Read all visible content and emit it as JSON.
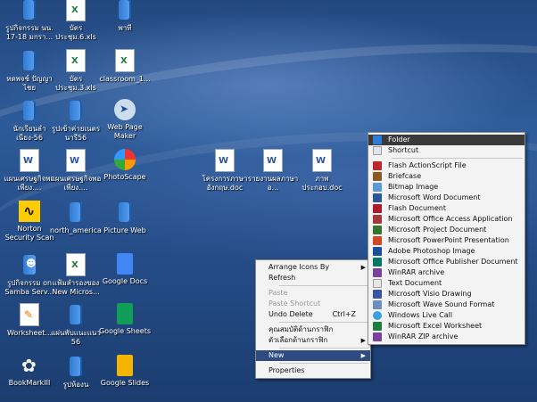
{
  "desktop": {
    "icons": [
      {
        "label": "รูปกิจกรรม นน. 17-18 มกรา...",
        "icon": "folder-icon"
      },
      {
        "label": "บัตรประชุม.6.xls",
        "icon": "excel-icon"
      },
      {
        "label": "พาที",
        "icon": "folder-icon"
      },
      {
        "label": "หดพจช์ ปัญญาไชย",
        "icon": "folder-icon"
      },
      {
        "label": "บัตรประชุม.3.xls",
        "icon": "excel-icon"
      },
      {
        "label": "classroom_1...",
        "icon": "excel-icon"
      },
      {
        "label": "นักเรียนลำเนียง-56",
        "icon": "folder-icon"
      },
      {
        "label": "รูปเข้าค่ายเนตรนารี56",
        "icon": "folder-icon"
      },
      {
        "label": "Web Page Maker",
        "icon": "web-page-maker-icon"
      },
      {
        "label": "แผนเศรษฐกิจพอเพียง....",
        "icon": "word-icon"
      },
      {
        "label": "แผนเศรษฐกิจพอเพียง....",
        "icon": "word-icon"
      },
      {
        "label": "PhotoScape",
        "icon": "photoscape-icon"
      },
      {
        "label": "โครงการภาษาอังกฤษ.doc",
        "icon": "word-icon"
      },
      {
        "label": "รายงานผลภาษาอ...",
        "icon": "word-icon"
      },
      {
        "label": "ภาพประกอบ.doc",
        "icon": "word-icon"
      },
      {
        "label": "Norton Security Scan",
        "icon": "norton-icon"
      },
      {
        "label": "north_america",
        "icon": "folder-icon"
      },
      {
        "label": "Picture Web",
        "icon": "folder-icon"
      },
      {
        "label": "รูปกิจกรรม on Samba Serv...",
        "icon": "person-folder-icon"
      },
      {
        "label": "แฟ้มสำรองของ New Micros...",
        "icon": "excel-icon"
      },
      {
        "label": "Google Docs",
        "icon": "google-docs-icon"
      },
      {
        "label": "Worksheet...",
        "icon": "pdf-icon"
      },
      {
        "label": "แผ่นพับแนะแนว 56",
        "icon": "folder-icon"
      },
      {
        "label": "Google Sheets",
        "icon": "google-sheets-icon"
      },
      {
        "label": "BookMarkIII",
        "icon": "bookmark-icon"
      },
      {
        "label": "รูปห้องน",
        "icon": "folder-icon"
      },
      {
        "label": "Google Slides",
        "icon": "google-slides-icon"
      }
    ]
  },
  "context_menu": {
    "items": [
      {
        "label": "Arrange Icons By",
        "type": "submenu"
      },
      {
        "label": "Refresh",
        "type": "item"
      },
      {
        "label": "Paste",
        "type": "disabled"
      },
      {
        "label": "Paste Shortcut",
        "type": "disabled"
      },
      {
        "label": "Undo Delete",
        "shortcut": "Ctrl+Z",
        "type": "item"
      },
      {
        "label": "คุณสมบัติด้านกราฟิก",
        "type": "item"
      },
      {
        "label": "ตัวเลือกด้านกราฟิก",
        "type": "submenu"
      },
      {
        "label": "New",
        "type": "submenu-selected"
      },
      {
        "label": "Properties",
        "type": "item"
      }
    ]
  },
  "new_submenu": {
    "items": [
      {
        "label": "Folder",
        "icon": "folder-icon",
        "color": "#2f7bd6"
      },
      {
        "label": "Shortcut",
        "icon": "shortcut-icon",
        "color": "#dfe6ef"
      },
      {
        "label": "Flash ActionScript File",
        "icon": "flash-as-icon",
        "color": "#c0272d"
      },
      {
        "label": "Briefcase",
        "icon": "briefcase-icon",
        "color": "#8a5a20"
      },
      {
        "label": "Bitmap Image",
        "icon": "bitmap-icon",
        "color": "#5b9bd5"
      },
      {
        "label": "Microsoft Word Document",
        "icon": "word-icon",
        "color": "#2b579a"
      },
      {
        "label": "Flash Document",
        "icon": "flash-icon",
        "color": "#b0182b"
      },
      {
        "label": "Microsoft Office Access Application",
        "icon": "access-icon",
        "color": "#a4373a"
      },
      {
        "label": "Microsoft Project Document",
        "icon": "project-icon",
        "color": "#31752f"
      },
      {
        "label": "Microsoft PowerPoint Presentation",
        "icon": "powerpoint-icon",
        "color": "#d24726"
      },
      {
        "label": "Adobe Photoshop Image",
        "icon": "photoshop-icon",
        "color": "#1a4f9c"
      },
      {
        "label": "Microsoft Office Publisher Document",
        "icon": "publisher-icon",
        "color": "#077568"
      },
      {
        "label": "WinRAR archive",
        "icon": "winrar-icon",
        "color": "#7b3f9e"
      },
      {
        "label": "Text Document",
        "icon": "text-icon",
        "color": "#e8e8e8"
      },
      {
        "label": "Microsoft Visio Drawing",
        "icon": "visio-icon",
        "color": "#3955a3"
      },
      {
        "label": "Microsoft Wave Sound Format",
        "icon": "wave-icon",
        "color": "#6d8fbf"
      },
      {
        "label": "Windows Live Call",
        "icon": "live-call-icon",
        "color": "#3ca0e0"
      },
      {
        "label": "Microsoft Excel Worksheet",
        "icon": "excel-icon",
        "color": "#1d7d3b"
      },
      {
        "label": "WinRAR ZIP archive",
        "icon": "winrar-zip-icon",
        "color": "#7b3f9e"
      }
    ]
  }
}
